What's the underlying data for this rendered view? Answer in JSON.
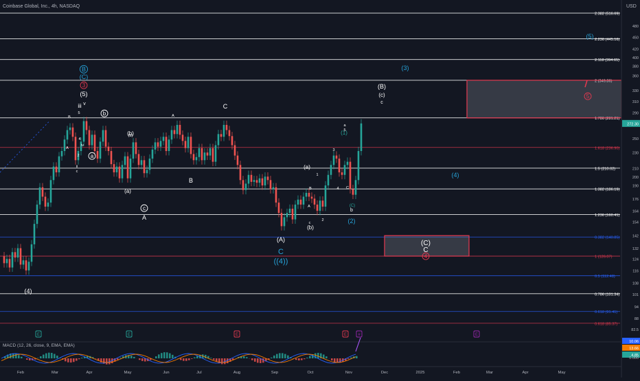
{
  "header": {
    "title": "Coinbase Global, Inc., 4h, NASDAQ",
    "currency": "USD"
  },
  "macd": {
    "label": "MACD (12, 26, close, 9, EMA, EMA)",
    "badges": [
      {
        "text": "10.06",
        "color": "#2962ff"
      },
      {
        "text": "13.66",
        "color": "#f57c00"
      },
      {
        "text": "4.85",
        "color": "#26a69a"
      }
    ],
    "axis_label": "0.000"
  },
  "chart_data": {
    "type": "line",
    "title": "Coinbase Global, Inc., 4h, NASDAQ",
    "xlabel": "",
    "ylabel": "",
    "ylim": [
      94,
      540
    ],
    "scale": "log",
    "grid": false,
    "x_tick_labels": [
      "Feb",
      "Mar",
      "Apr",
      "May",
      "Jun",
      "Jul",
      "Aug",
      "Sep",
      "Oct",
      "Nov",
      "Dec",
      "2025",
      "Feb",
      "Mar",
      "Apr",
      "May"
    ],
    "y_tick_labels": [
      480,
      450,
      420,
      400,
      380,
      360,
      330,
      310,
      290,
      270,
      250,
      230,
      210,
      200,
      190,
      176,
      164,
      154,
      142,
      132,
      124,
      116,
      108,
      101,
      94,
      88,
      82.5
    ],
    "last_price": 272.3,
    "fib_levels": [
      {
        "label": "2.382 (516.69)",
        "value": 516.69,
        "color": "#ffffff"
      },
      {
        "label": "2.236 (445.16)",
        "value": 445.16,
        "color": "#ffffff"
      },
      {
        "label": "2.118 (394.65)",
        "value": 394.65,
        "color": "#ffffff"
      },
      {
        "label": "2 (349.86)",
        "value": 349.86,
        "color": "#ffffff"
      },
      {
        "label": "1.786 (281.21)",
        "value": 281.21,
        "color": "#ffffff"
      },
      {
        "label": "1.618 (236.90)",
        "value": 236.9,
        "color": "#e53950"
      },
      {
        "label": "1.5 (210.02)",
        "value": 210.02,
        "color": "#ffffff"
      },
      {
        "label": "1.382 (186.19)",
        "value": 186.19,
        "color": "#ffffff"
      },
      {
        "label": "1.236 (160.41)",
        "value": 160.41,
        "color": "#ffffff"
      },
      {
        "label": "0.382 (140.85)",
        "value": 140.85,
        "color": "#2962ff"
      },
      {
        "label": "1 (126.07)",
        "value": 126.07,
        "color": "#e53950"
      },
      {
        "label": "0.5 (112.48)",
        "value": 112.48,
        "color": "#2962ff"
      },
      {
        "label": "0.786 (101.34)",
        "value": 101.34,
        "color": "#ffffff"
      },
      {
        "label": "0.618 (91.41)",
        "value": 91.41,
        "color": "#2962ff"
      },
      {
        "label": "0.618 (85.37)",
        "value": 85.37,
        "color": "#e53950"
      }
    ],
    "series": [
      {
        "values": [
          [
            0,
            126
          ],
          [
            4,
            121
          ],
          [
            8,
            124
          ],
          [
            12,
            118
          ],
          [
            16,
            129
          ],
          [
            20,
            125
          ],
          [
            24,
            132
          ],
          [
            28,
            120
          ],
          [
            32,
            123
          ],
          [
            36,
            116
          ],
          [
            40,
            122
          ],
          [
            44,
            135
          ],
          [
            48,
            152
          ],
          [
            52,
            170
          ],
          [
            56,
            188
          ],
          [
            60,
            178
          ],
          [
            64,
            168
          ],
          [
            68,
            172
          ],
          [
            72,
            196
          ],
          [
            76,
            212
          ],
          [
            80,
            205
          ],
          [
            84,
            225
          ],
          [
            88,
            232
          ],
          [
            92,
            248
          ],
          [
            96,
            262
          ],
          [
            100,
            266
          ],
          [
            104,
            252
          ],
          [
            108,
            220
          ],
          [
            112,
            232
          ],
          [
            116,
            245
          ],
          [
            120,
            276
          ],
          [
            124,
            262
          ],
          [
            128,
            240
          ],
          [
            132,
            255
          ],
          [
            136,
            232
          ],
          [
            140,
            222
          ],
          [
            144,
            245
          ],
          [
            148,
            262
          ],
          [
            152,
            238
          ],
          [
            156,
            232
          ],
          [
            160,
            215
          ],
          [
            164,
            205
          ],
          [
            168,
            212
          ],
          [
            172,
            198
          ],
          [
            176,
            214
          ],
          [
            180,
            225
          ],
          [
            184,
            198
          ],
          [
            188,
            222
          ],
          [
            192,
            244
          ],
          [
            196,
            228
          ],
          [
            200,
            214
          ],
          [
            204,
            220
          ],
          [
            208,
            204
          ],
          [
            212,
            208
          ],
          [
            216,
            222
          ],
          [
            220,
            234
          ],
          [
            224,
            244
          ],
          [
            228,
            238
          ],
          [
            232,
            246
          ],
          [
            236,
            252
          ],
          [
            240,
            232
          ],
          [
            244,
            248
          ],
          [
            248,
            262
          ],
          [
            252,
            256
          ],
          [
            256,
            270
          ],
          [
            260,
            255
          ],
          [
            264,
            246
          ],
          [
            268,
            236
          ],
          [
            272,
            252
          ],
          [
            276,
            228
          ],
          [
            280,
            220
          ],
          [
            284,
            224
          ],
          [
            288,
            236
          ],
          [
            292,
            220
          ],
          [
            296,
            230
          ],
          [
            300,
            226
          ],
          [
            304,
            236
          ],
          [
            308,
            218
          ],
          [
            312,
            240
          ],
          [
            316,
            256
          ],
          [
            320,
            252
          ],
          [
            324,
            270
          ],
          [
            328,
            262
          ],
          [
            332,
            253
          ],
          [
            336,
            240
          ],
          [
            340,
            226
          ],
          [
            344,
            214
          ],
          [
            348,
            196
          ],
          [
            352,
            185
          ],
          [
            356,
            192
          ],
          [
            360,
            202
          ],
          [
            364,
            194
          ],
          [
            368,
            196
          ],
          [
            372,
            193
          ],
          [
            376,
            198
          ],
          [
            380,
            190
          ],
          [
            384,
            200
          ],
          [
            388,
            196
          ],
          [
            392,
            186
          ],
          [
            396,
            188
          ],
          [
            400,
            172
          ],
          [
            404,
            162
          ],
          [
            408,
            150
          ],
          [
            412,
            158
          ],
          [
            416,
            162
          ],
          [
            420,
            166
          ],
          [
            424,
            156
          ],
          [
            428,
            170
          ],
          [
            432,
            175
          ],
          [
            436,
            170
          ],
          [
            440,
            178
          ],
          [
            444,
            182
          ],
          [
            448,
            178
          ],
          [
            452,
            176
          ],
          [
            456,
            170
          ],
          [
            460,
            164
          ],
          [
            464,
            174
          ],
          [
            468,
            168
          ],
          [
            472,
            190
          ],
          [
            476,
            202
          ],
          [
            480,
            214
          ],
          [
            484,
            226
          ],
          [
            488,
            222
          ],
          [
            492,
            205
          ],
          [
            496,
            202
          ],
          [
            500,
            214
          ],
          [
            504,
            218
          ],
          [
            508,
            186
          ],
          [
            512,
            180
          ],
          [
            516,
            196
          ],
          [
            520,
            232
          ],
          [
            524,
            272.3
          ]
        ]
      }
    ],
    "wave_labels": [
      {
        "text": "B",
        "circled": true,
        "color": "#26a3d9"
      },
      {
        "text": "(C)",
        "color": "#26a3d9"
      },
      {
        "text": "3",
        "circled": true,
        "color": "#e53950"
      },
      {
        "text": "(5)",
        "color": "#ffffff"
      },
      {
        "text": "iii",
        "color": "#ffffff"
      },
      {
        "text": "v",
        "color": "#ffffff"
      },
      {
        "text": "b",
        "circled": true,
        "color": "#ffffff"
      },
      {
        "text": "a",
        "circled": true,
        "color": "#ffffff"
      },
      {
        "text": "(b)",
        "color": "#ffffff"
      },
      {
        "text": "(a)",
        "color": "#ffffff"
      },
      {
        "text": "c",
        "circled": true,
        "color": "#ffffff"
      },
      {
        "text": "A",
        "color": "#ffffff"
      },
      {
        "text": "B",
        "color": "#ffffff"
      },
      {
        "text": "C",
        "color": "#ffffff"
      },
      {
        "text": "(A)",
        "color": "#ffffff"
      },
      {
        "text": "C",
        "color": "#26a3d9"
      },
      {
        "text": "((4))",
        "color": "#26a3d9"
      },
      {
        "text": "(4)",
        "color": "#ffffff"
      },
      {
        "text": "(b)",
        "color": "#ffffff"
      },
      {
        "text": "(a)",
        "color": "#ffffff"
      },
      {
        "text": "(1)",
        "color": "#26a69a"
      },
      {
        "text": "(2)",
        "color": "#26a3d9"
      },
      {
        "text": "(B)",
        "color": "#ffffff"
      },
      {
        "text": "(c)",
        "color": "#ffffff"
      },
      {
        "text": "c",
        "color": "#ffffff"
      },
      {
        "text": "(3)",
        "color": "#26a3d9"
      },
      {
        "text": "(4)",
        "color": "#26a3d9"
      },
      {
        "text": "(5)",
        "color": "#26a3d9"
      },
      {
        "text": "(C)",
        "color": "#ffffff"
      },
      {
        "text": "C",
        "color": "#ffffff"
      },
      {
        "text": "4",
        "circled": true,
        "color": "#e53950"
      },
      {
        "text": "5",
        "circled": true,
        "color": "#e53950"
      },
      {
        "text": "b",
        "color": "#ffffff"
      },
      {
        "text": "(C)",
        "color": "#26a69a"
      }
    ],
    "target_boxes": [
      {
        "from": 281.21,
        "to": 349.86,
        "color": "#e53950"
      },
      {
        "from": 126.07,
        "to": 142,
        "color": "#e53950"
      }
    ],
    "event_markers": [
      {
        "text": "E",
        "color": "#26a69a"
      },
      {
        "text": "E",
        "color": "#26a69a"
      },
      {
        "text": "E",
        "color": "#e53950"
      },
      {
        "text": "E",
        "color": "#e53950"
      },
      {
        "text": "#",
        "color": "#9c27b0"
      },
      {
        "text": "E",
        "color": "#9c27b0"
      }
    ]
  }
}
